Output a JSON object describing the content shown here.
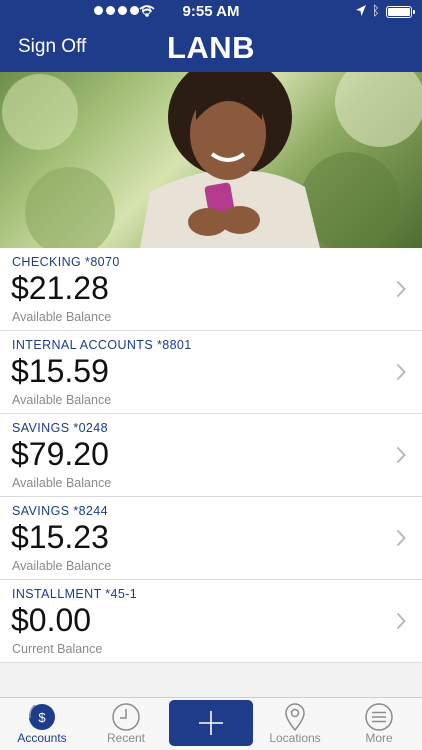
{
  "status_bar": {
    "time": "9:55 AM"
  },
  "nav": {
    "left_action": "Sign Off",
    "title": "LANB"
  },
  "accounts": [
    {
      "name": "CHECKING *8070",
      "amount": "$21.28",
      "label": "Available Balance"
    },
    {
      "name": "INTERNAL ACCOUNTS *8801",
      "amount": "$15.59",
      "label": "Available Balance"
    },
    {
      "name": "SAVINGS *0248",
      "amount": "$79.20",
      "label": "Available Balance"
    },
    {
      "name": "SAVINGS *8244",
      "amount": "$15.23",
      "label": "Available Balance"
    },
    {
      "name": "INSTALLMENT *45-1",
      "amount": "$0.00",
      "label": "Current Balance"
    }
  ],
  "tabs": [
    {
      "label": "Accounts",
      "icon": "dollar-coin-icon",
      "active": true
    },
    {
      "label": "Recent",
      "icon": "clock-icon",
      "active": false
    },
    {
      "label": "",
      "icon": "plus-icon",
      "active": false
    },
    {
      "label": "Locations",
      "icon": "map-pin-icon",
      "active": false
    },
    {
      "label": "More",
      "icon": "menu-icon",
      "active": false
    }
  ],
  "colors": {
    "brand": "#1e3c8a",
    "muted": "#8a8a8a"
  }
}
